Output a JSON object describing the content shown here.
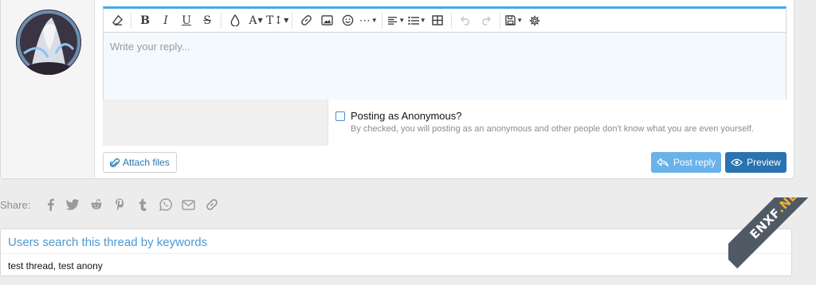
{
  "editor": {
    "placeholder": "Write your reply...",
    "toolbar": [
      {
        "name": "eraser-icon"
      },
      {
        "name": "bold-icon"
      },
      {
        "name": "italic-icon"
      },
      {
        "name": "underline-icon"
      },
      {
        "name": "strikethrough-icon"
      },
      {
        "name": "text-color-icon"
      },
      {
        "name": "font-family-icon"
      },
      {
        "name": "font-size-icon"
      },
      {
        "name": "link-icon"
      },
      {
        "name": "image-icon"
      },
      {
        "name": "emoji-icon"
      },
      {
        "name": "more-options-icon"
      },
      {
        "name": "align-icon"
      },
      {
        "name": "list-icon"
      },
      {
        "name": "table-icon"
      },
      {
        "name": "undo-icon"
      },
      {
        "name": "redo-icon"
      },
      {
        "name": "drafts-icon"
      },
      {
        "name": "settings-icon"
      }
    ],
    "accent_color": "#47a7eb"
  },
  "anonymous": {
    "label": "Posting as Anonymous?",
    "hint": "By checked, you will posting as an anonymous and other people don't know what you are even yourself.",
    "checked": false
  },
  "buttons": {
    "attach": "Attach files",
    "post_reply": "Post reply",
    "preview": "Preview"
  },
  "share": {
    "label": "Share:",
    "icons": [
      "facebook-icon",
      "twitter-icon",
      "reddit-icon",
      "pinterest-icon",
      "tumblr-icon",
      "whatsapp-icon",
      "email-icon",
      "link-icon"
    ]
  },
  "keywords": {
    "title": "Users search this thread by keywords",
    "text": "test thread, test anony"
  },
  "watermark": {
    "name": "ENXF",
    "tld": ".NET"
  }
}
